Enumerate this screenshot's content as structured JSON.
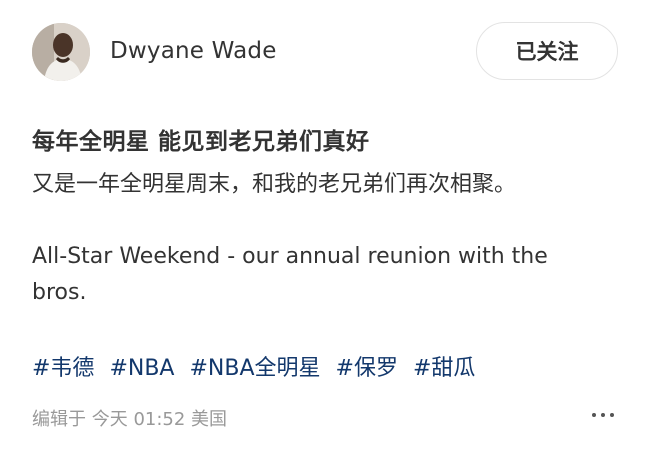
{
  "author": {
    "name": "Dwyane Wade",
    "avatar_icon": "person-avatar-icon"
  },
  "header": {
    "follow_label": "已关注"
  },
  "note": {
    "title": "每年全明星 能见到老兄弟们真好",
    "paragraphs": [
      "又是一年全明星周末，和我的老兄弟们再次相聚。",
      "All-Star Weekend - our annual reunion with the bros."
    ],
    "tags": [
      "#韦德",
      "#NBA",
      "#NBA全明星",
      "#保罗",
      "#甜瓜"
    ]
  },
  "footer": {
    "meta": "编辑于 今天 01:52 美国",
    "more_icon": "more-dots-icon"
  },
  "colors": {
    "text": "#333333",
    "tag": "#13386c",
    "muted": "#999999",
    "button_border": "#e3e3e3"
  }
}
